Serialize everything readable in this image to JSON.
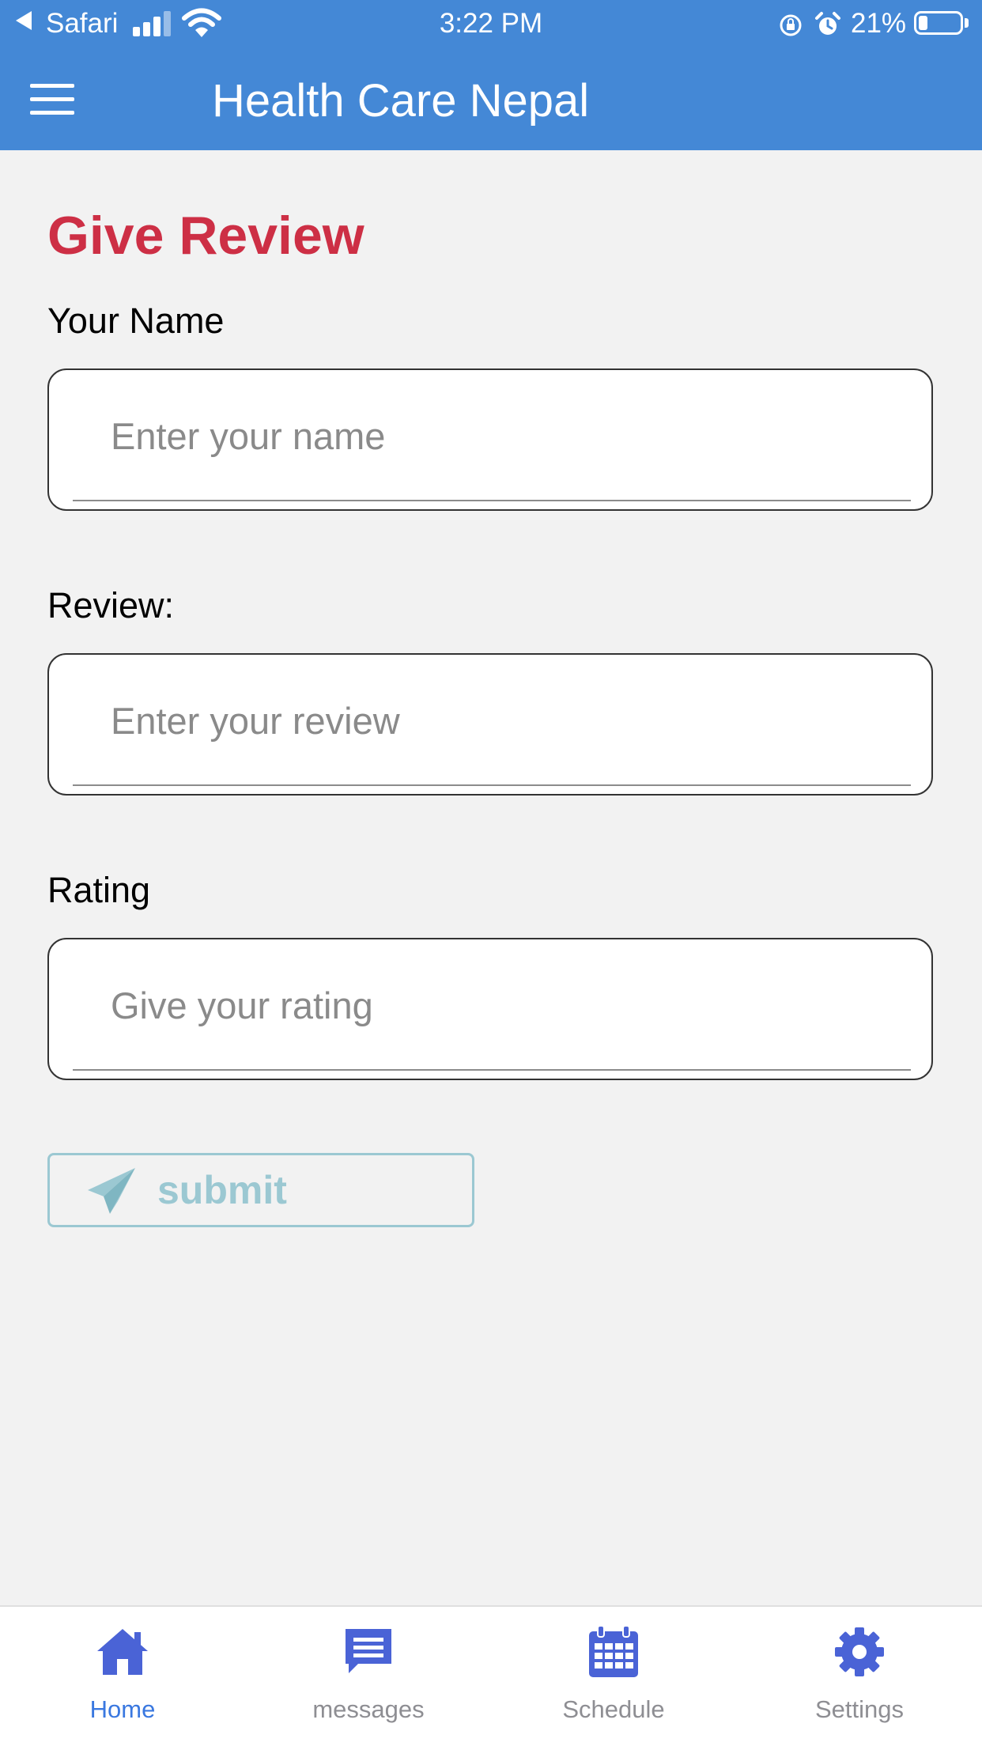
{
  "status_bar": {
    "back_app": "Safari",
    "time": "3:22 PM",
    "battery_percent": "21%",
    "battery_level": 0.21
  },
  "header": {
    "title": "Health Care Nepal",
    "menu_icon": "hamburger-menu-icon"
  },
  "form": {
    "title": "Give Review",
    "name": {
      "label": "Your Name",
      "placeholder": "Enter your name",
      "value": ""
    },
    "review": {
      "label": "Review:",
      "placeholder": "Enter your review",
      "value": ""
    },
    "rating": {
      "label": "Rating",
      "placeholder": "Give your rating",
      "value": ""
    },
    "submit": {
      "label": "submit",
      "icon": "paper-plane-icon"
    }
  },
  "colors": {
    "header_bg": "#4488d6",
    "title_red": "#cd2f45",
    "submit_teal": "#9bc8d2",
    "tab_icon": "#4a63d6",
    "tab_active_label": "#3a78e0",
    "tab_inactive_label": "#8e8e93"
  },
  "tab_bar": {
    "items": [
      {
        "label": "Home",
        "icon": "home-icon",
        "active": true
      },
      {
        "label": "messages",
        "icon": "message-icon",
        "active": false
      },
      {
        "label": "Schedule",
        "icon": "calendar-icon",
        "active": false
      },
      {
        "label": "Settings",
        "icon": "gear-icon",
        "active": false
      }
    ]
  }
}
